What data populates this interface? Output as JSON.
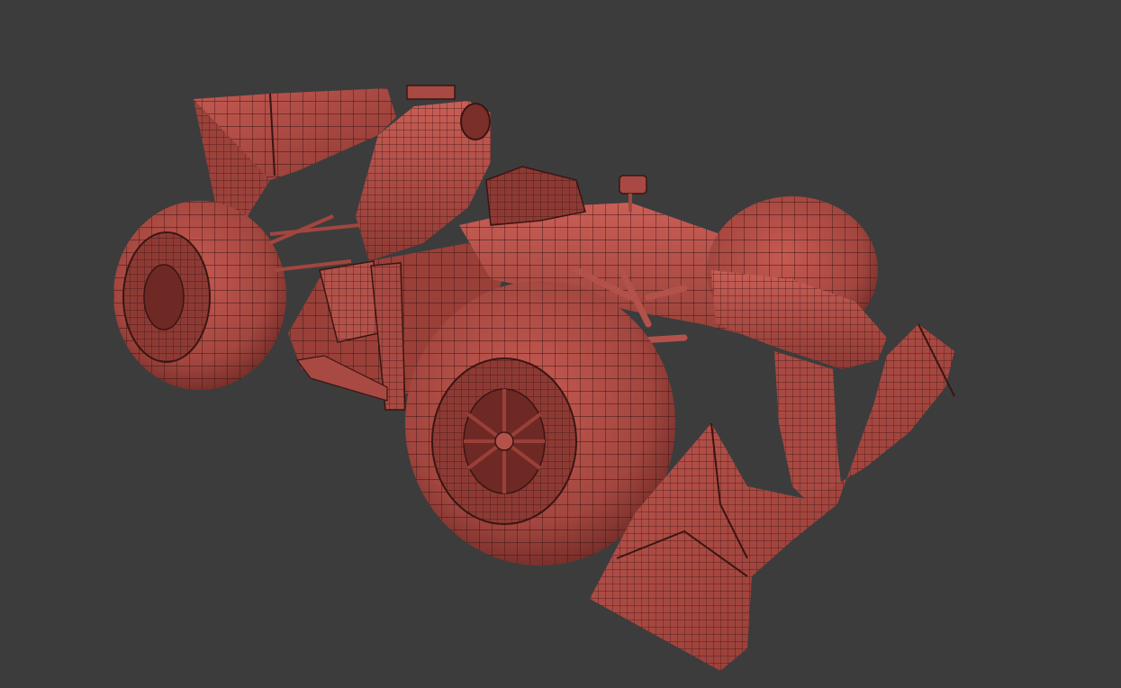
{
  "viewport": {
    "background": "#3c3c3c",
    "render_mode": "wireframe-on-shaded",
    "model": {
      "subject": "formula-one-race-car",
      "surface_color": "#b24d45",
      "surface_shadow": "#7a2f2a",
      "surface_highlight": "#d26a60",
      "wire_color": "#3a1512"
    }
  }
}
